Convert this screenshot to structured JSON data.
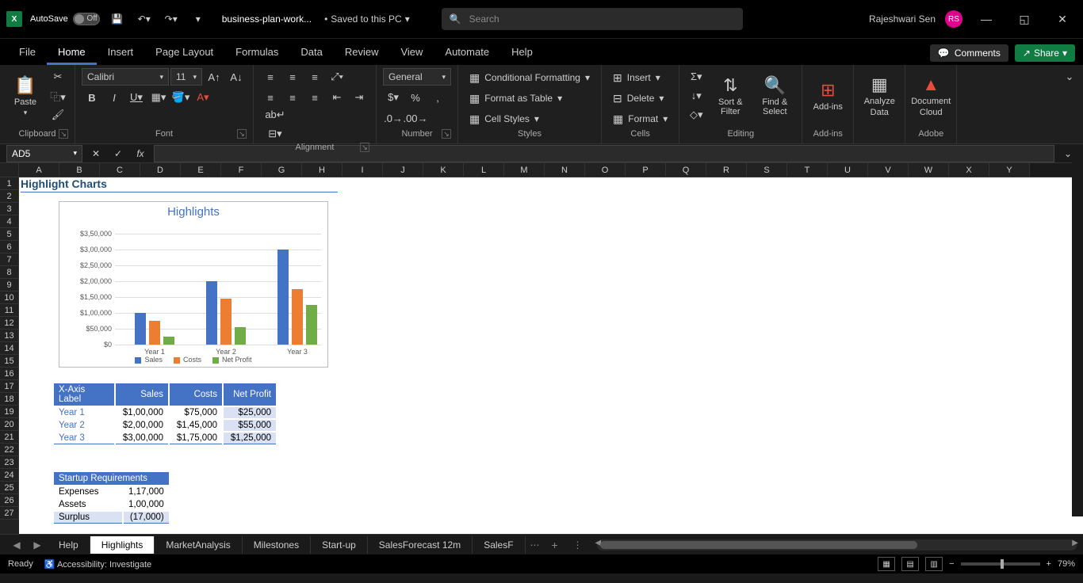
{
  "titlebar": {
    "autosave_label": "AutoSave",
    "autosave_state": "Off",
    "file_name": "business-plan-work...",
    "saved_status": "Saved to this PC",
    "search_placeholder": "Search",
    "user_name": "Rajeshwari Sen",
    "user_initials": "RS"
  },
  "ribbon_tabs": [
    "File",
    "Home",
    "Insert",
    "Page Layout",
    "Formulas",
    "Data",
    "Review",
    "View",
    "Automate",
    "Help"
  ],
  "ribbon_active": "Home",
  "comments_label": "Comments",
  "share_label": "Share",
  "ribbon": {
    "clipboard": {
      "paste": "Paste",
      "label": "Clipboard"
    },
    "font": {
      "name": "Calibri",
      "size": "11",
      "label": "Font"
    },
    "alignment": {
      "label": "Alignment"
    },
    "number": {
      "format": "General",
      "label": "Number"
    },
    "styles": {
      "cond_format": "Conditional Formatting",
      "format_table": "Format as Table",
      "cell_styles": "Cell Styles",
      "label": "Styles"
    },
    "cells": {
      "insert": "Insert",
      "delete": "Delete",
      "format": "Format",
      "label": "Cells"
    },
    "editing": {
      "sort": "Sort & Filter",
      "find": "Find & Select",
      "label": "Editing"
    },
    "addins": {
      "addins": "Add-ins",
      "label": "Add-ins"
    },
    "analyze": {
      "label_top": "Analyze",
      "label_bot": "Data"
    },
    "adobe": {
      "label_top": "Document",
      "label_bot": "Cloud",
      "group": "Adobe"
    }
  },
  "name_box": "AD5",
  "columns": [
    "A",
    "B",
    "C",
    "D",
    "E",
    "F",
    "G",
    "H",
    "I",
    "J",
    "K",
    "L",
    "M",
    "N",
    "O",
    "P",
    "Q",
    "R",
    "S",
    "T",
    "U",
    "V",
    "W",
    "X",
    "Y"
  ],
  "rows": [
    1,
    2,
    3,
    4,
    5,
    6,
    7,
    8,
    9,
    10,
    11,
    12,
    13,
    14,
    15,
    16,
    17,
    18,
    19,
    20,
    21,
    22,
    23,
    24,
    25,
    26,
    27
  ],
  "section_title": "Highlight Charts",
  "table": {
    "headers": [
      "X-Axis Label",
      "Sales",
      "Costs",
      "Net Profit"
    ],
    "rows": [
      {
        "label": "Year 1",
        "sales": "$1,00,000",
        "costs": "$75,000",
        "profit": "$25,000"
      },
      {
        "label": "Year 2",
        "sales": "$2,00,000",
        "costs": "$1,45,000",
        "profit": "$55,000"
      },
      {
        "label": "Year 3",
        "sales": "$3,00,000",
        "costs": "$1,75,000",
        "profit": "$1,25,000"
      }
    ]
  },
  "startup": {
    "title": "Startup Requirements",
    "rows": [
      {
        "label": "Expenses",
        "value": "1,17,000"
      },
      {
        "label": "Assets",
        "value": "1,00,000"
      },
      {
        "label": "Surplus",
        "value": "(17,000)"
      }
    ]
  },
  "chart_data": {
    "type": "bar",
    "title": "Highlights",
    "categories": [
      "Year 1",
      "Year 2",
      "Year 3"
    ],
    "series": [
      {
        "name": "Sales",
        "values": [
          100000,
          200000,
          300000
        ],
        "color": "#4472c4"
      },
      {
        "name": "Costs",
        "values": [
          75000,
          145000,
          175000
        ],
        "color": "#ed7d31"
      },
      {
        "name": "Net Profit",
        "values": [
          25000,
          55000,
          125000
        ],
        "color": "#70ad47"
      }
    ],
    "y_ticks": [
      "$0",
      "$50,000",
      "$1,00,000",
      "$1,50,000",
      "$2,00,000",
      "$2,50,000",
      "$3,00,000",
      "$3,50,000"
    ],
    "ymax": 350000
  },
  "sheet_tabs": [
    "Help",
    "Highlights",
    "MarketAnalysis",
    "Milestones",
    "Start-up",
    "SalesForecast 12m",
    "SalesF"
  ],
  "active_sheet": "Highlights",
  "status": {
    "ready": "Ready",
    "accessibility": "Accessibility: Investigate",
    "zoom": "79%"
  }
}
